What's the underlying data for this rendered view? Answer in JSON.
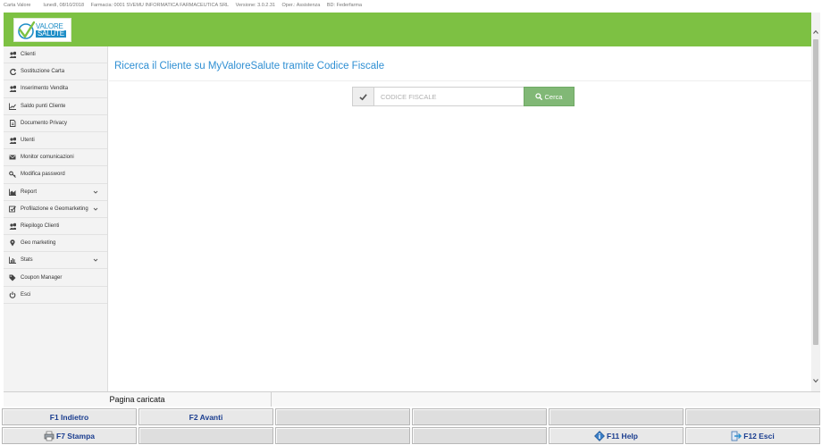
{
  "topbar": {
    "app": "Carta Valore",
    "date": "lunedì, 08/10/2018",
    "farmacia": "Farmacia: 0001 SVEMU INFORMATICA FARMACEUTICA SRL",
    "versione": "Versione: 3.0.2.31",
    "operatore": "Oper.: Assistenza",
    "db": "BD: Federfarma"
  },
  "logo": {
    "line1": "VALORE",
    "line2": "SALUTE"
  },
  "colors": {
    "header_green": "#7dc143",
    "title_blue": "#2f8fd3",
    "search_button": "#81b876",
    "fkey_text": "#1a3d8f"
  },
  "sidebar": {
    "items": [
      {
        "label": "Clienti",
        "icon": "users-icon",
        "expandable": false
      },
      {
        "label": "Sostituzione Carta",
        "icon": "refresh-icon",
        "expandable": false
      },
      {
        "label": "Inserimento Vendita",
        "icon": "users-icon",
        "expandable": false
      },
      {
        "label": "Saldo punti Cliente",
        "icon": "line-chart-icon",
        "expandable": false
      },
      {
        "label": "Documento Privacy",
        "icon": "document-icon",
        "expandable": false
      },
      {
        "label": "Utenti",
        "icon": "users-icon",
        "expandable": false
      },
      {
        "label": "Monitor comunicazioni",
        "icon": "envelope-icon",
        "expandable": false
      },
      {
        "label": "Modifica password",
        "icon": "key-icon",
        "expandable": false
      },
      {
        "label": "Report",
        "icon": "area-chart-icon",
        "expandable": true
      },
      {
        "label": "Profilazione e Geomarketing",
        "icon": "checkbox-icon",
        "expandable": true
      },
      {
        "label": "Riepilogo Clienti",
        "icon": "users-icon",
        "expandable": false
      },
      {
        "label": "Geo marketing",
        "icon": "map-marker-icon",
        "expandable": false
      },
      {
        "label": "Stats",
        "icon": "bar-chart-icon",
        "expandable": true
      },
      {
        "label": "Coupon Manager",
        "icon": "tags-icon",
        "expandable": false
      },
      {
        "label": "Esci",
        "icon": "power-icon",
        "expandable": false
      }
    ]
  },
  "main": {
    "title": "Ricerca il Cliente su MyValoreSalute tramite Codice Fiscale",
    "search": {
      "placeholder": "CODICE FISCALE",
      "value": "",
      "button_label": "Cerca"
    }
  },
  "status": {
    "message": "Pagina caricata"
  },
  "fkeys": {
    "f1": "F1 Indietro",
    "f2": "F2 Avanti",
    "f7": "F7 Stampa",
    "f11": "F11 Help",
    "f12": "F12 Esci"
  }
}
